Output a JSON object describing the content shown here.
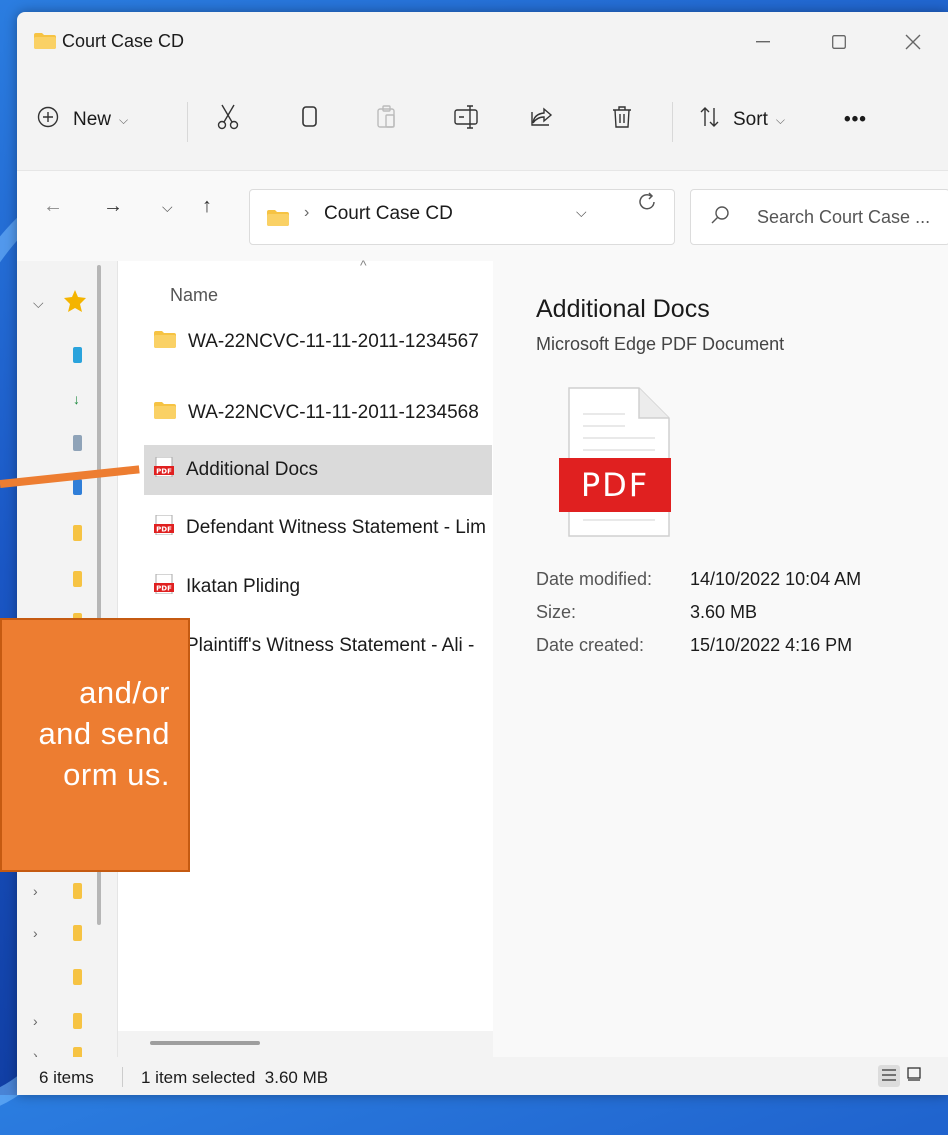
{
  "window": {
    "title": "Court Case CD",
    "controls": [
      "minimize",
      "maximize",
      "close"
    ]
  },
  "toolbar": {
    "new_label": "New",
    "sort_label": "Sort",
    "more_label": "•••",
    "actions": [
      "cut",
      "copy",
      "paste",
      "rename",
      "share",
      "delete"
    ]
  },
  "address": {
    "path": "Court Case CD",
    "separator": "›"
  },
  "search": {
    "placeholder": "Search Court Case ..."
  },
  "filelist": {
    "column_name": "Name",
    "items": [
      {
        "name": "WA-22NCVC-11-11-2011-1234567",
        "type": "folder",
        "selected": false
      },
      {
        "name": "WA-22NCVC-11-11-2011-1234568",
        "type": "folder",
        "selected": false
      },
      {
        "name": "Additional Docs",
        "type": "pdf",
        "selected": true
      },
      {
        "name": "Defendant Witness Statement - Lim",
        "type": "pdf",
        "selected": false
      },
      {
        "name": "Ikatan Pliding",
        "type": "pdf",
        "selected": false
      },
      {
        "name": "Plaintiff's Witness Statement - Ali -",
        "type": "pdf",
        "selected": false
      }
    ]
  },
  "preview": {
    "title": "Additional Docs",
    "type": "Microsoft Edge PDF Document",
    "icon_label": "PDF",
    "details": [
      {
        "label": "Date modified:",
        "value": "14/10/2022 10:04 AM"
      },
      {
        "label": "Size:",
        "value": "3.60 MB"
      },
      {
        "label": "Date created:",
        "value": "15/10/2022 4:16 PM"
      }
    ]
  },
  "status": {
    "item_count": "6 items",
    "selection": "1 item selected  3.60 MB"
  },
  "annotation": {
    "line1": "and/or",
    "line2": "and send",
    "line3": "orm us."
  },
  "colors": {
    "accent_orange": "#ed7d31",
    "folder_yellow": "#f6c343",
    "pdf_red": "#e02020"
  }
}
